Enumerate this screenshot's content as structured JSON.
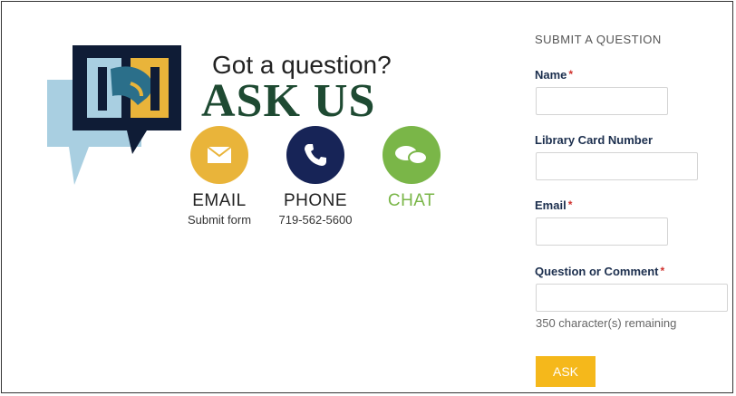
{
  "promo": {
    "tagline": "Got a question?",
    "headline": "ASK US",
    "contacts": [
      {
        "label": "EMAIL",
        "sub": "Submit form",
        "icon": "envelope-icon",
        "color": "#e9b43a",
        "label_color": "#222222"
      },
      {
        "label": "PHONE",
        "sub": "719-562-5600",
        "icon": "phone-icon",
        "color": "#172457",
        "label_color": "#222222"
      },
      {
        "label": "CHAT",
        "sub": "",
        "icon": "chat-bubbles-icon",
        "color": "#7ab648",
        "label_color": "#7ab648"
      }
    ],
    "logo_colors": {
      "bubble_light": "#a9cfe1",
      "bubble_dark": "#0f1c36",
      "gold": "#e9b43a",
      "teal": "#2b6f8a"
    }
  },
  "form": {
    "title": "SUBMIT A QUESTION",
    "fields": [
      {
        "label": "Name",
        "required": true,
        "required_mark": "*",
        "value": "",
        "placeholder": ""
      },
      {
        "label": "Library Card Number",
        "required": false,
        "required_mark": "",
        "value": "",
        "placeholder": ""
      },
      {
        "label": "Email",
        "required": true,
        "required_mark": "*",
        "value": "",
        "placeholder": ""
      },
      {
        "label": "Question or Comment",
        "required": true,
        "required_mark": "*",
        "value": "",
        "placeholder": ""
      }
    ],
    "counter_text": "350 character(s) remaining",
    "submit_label": "ASK",
    "accent_color": "#f5b81b"
  }
}
